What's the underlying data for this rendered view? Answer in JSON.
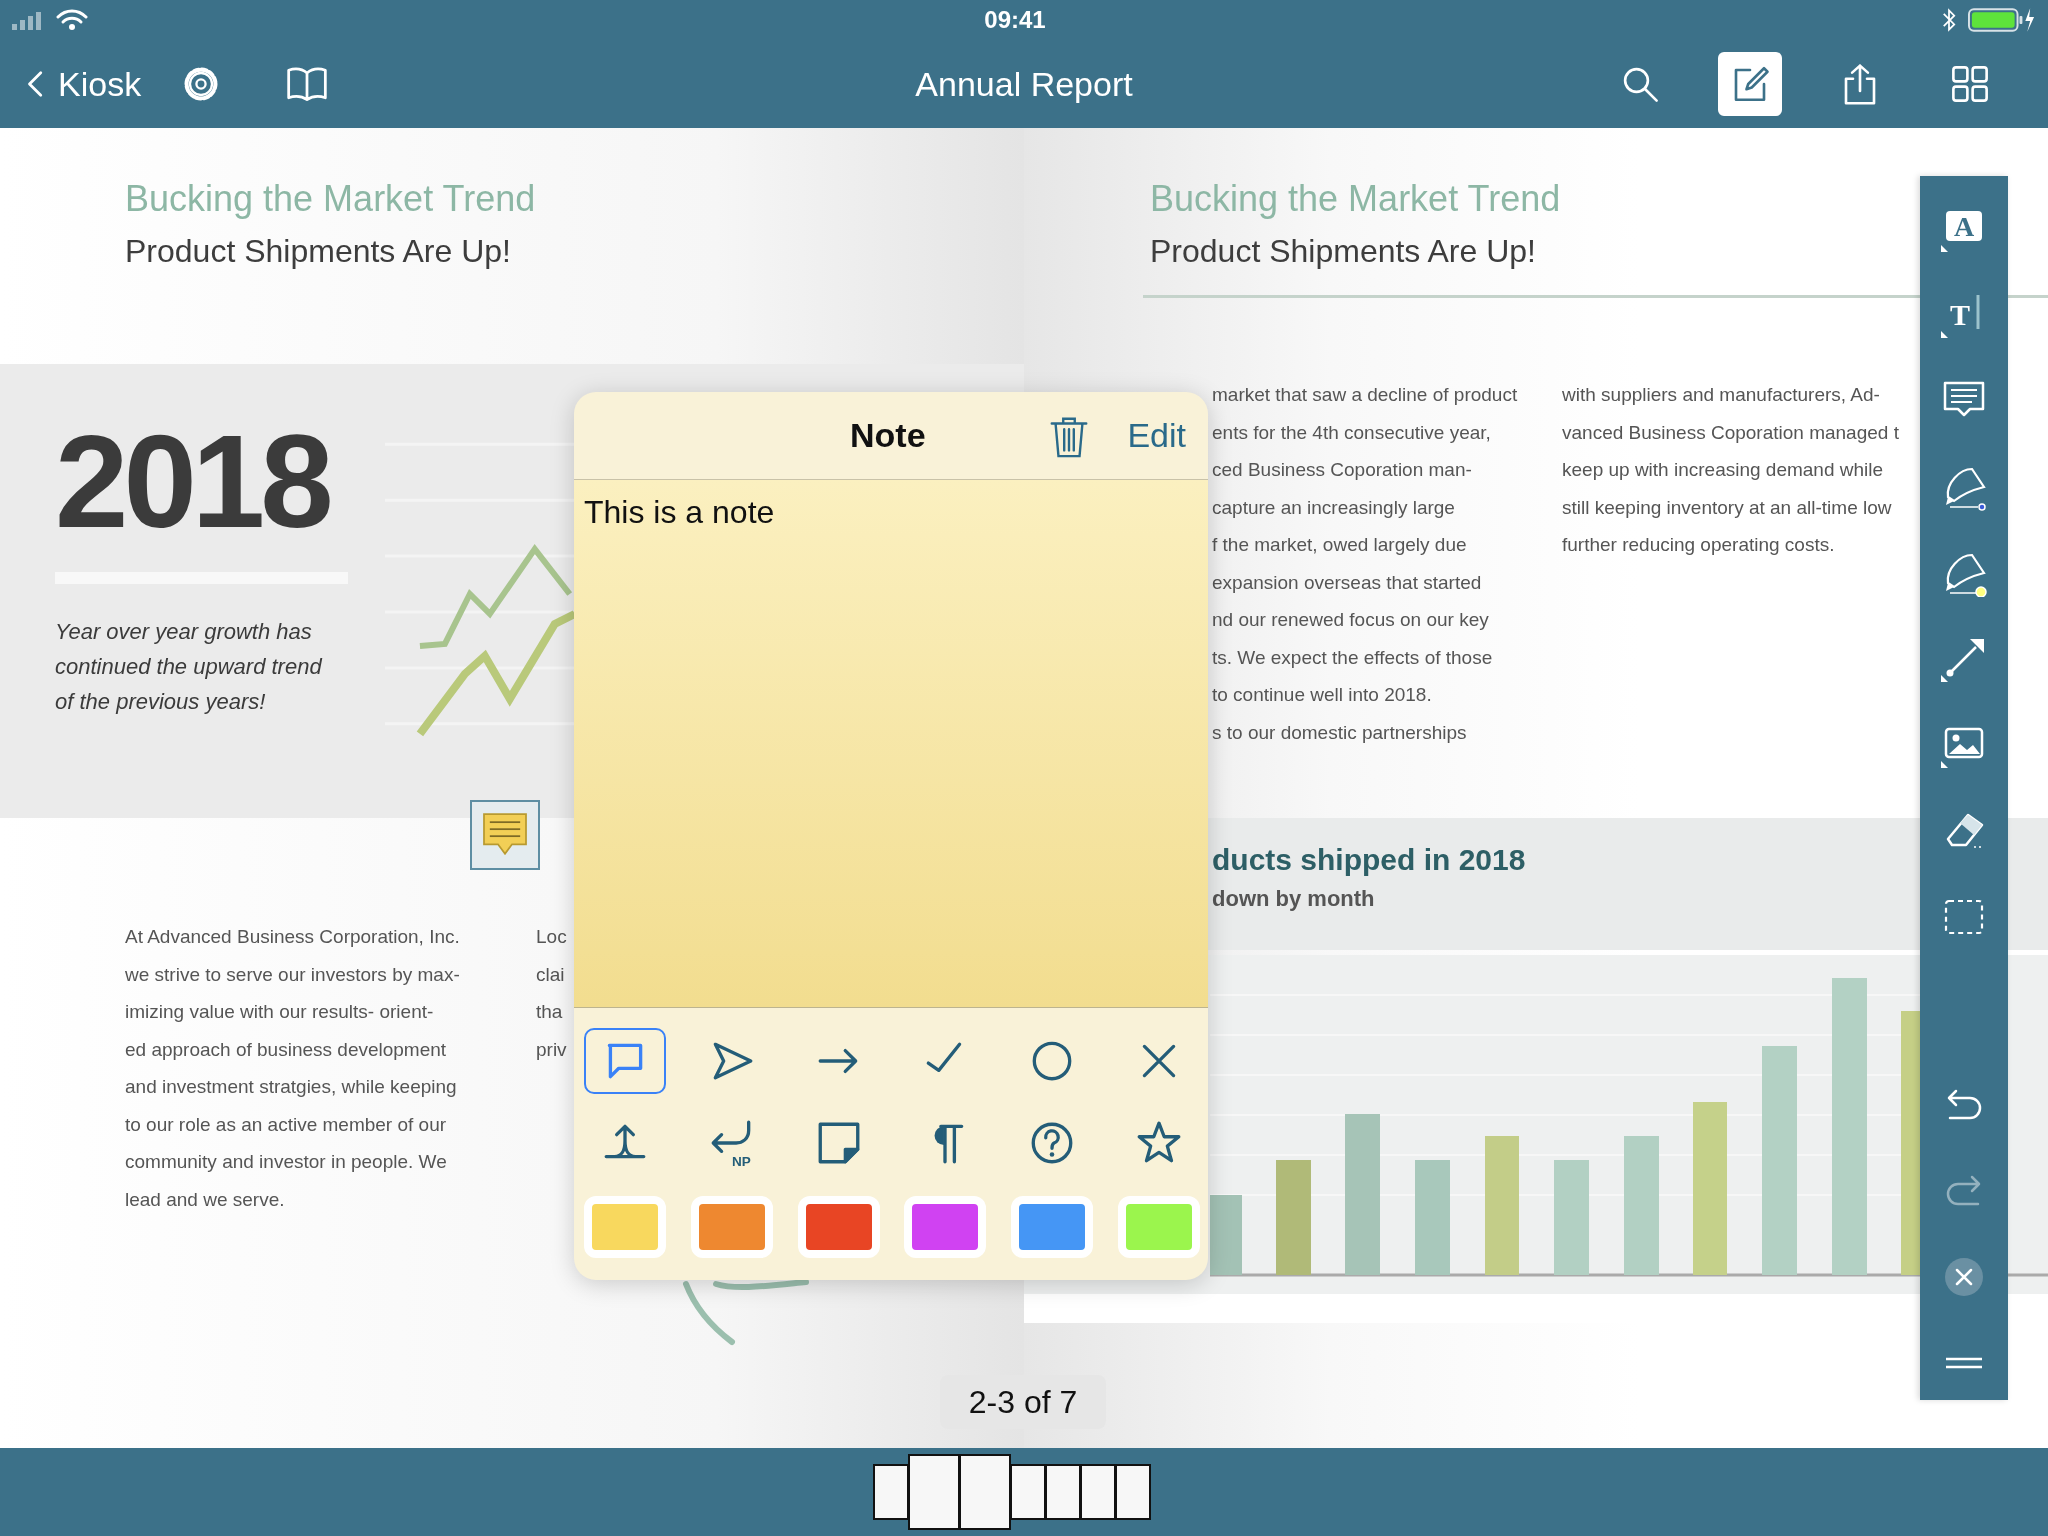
{
  "status_bar": {
    "time": "09:41"
  },
  "nav_bar": {
    "back": "Kiosk",
    "title": "Annual Report",
    "left_tools": [
      {
        "kind": "settings"
      },
      {
        "kind": "book"
      }
    ],
    "right_tools": [
      {
        "kind": "search",
        "selected": false
      },
      {
        "kind": "edit",
        "selected": true
      },
      {
        "kind": "share",
        "selected": false
      },
      {
        "kind": "grid",
        "selected": false
      }
    ]
  },
  "left_page": {
    "heading": "Bucking the Market Trend",
    "subheading": "Product Shipments Are Up!",
    "year": "2018",
    "tagline": [
      "Year over year growth has",
      "continued the upward trend",
      "of the previous years!"
    ],
    "column_1": [
      "At Advanced Business Corporation, Inc.",
      "we strive to serve our investors  by max-",
      "imizing value with our results- orient-",
      "ed approach of business development",
      "and investment stratgies, while keeping",
      "to our role as an active member of our",
      "community and investor in people. We",
      "lead and we serve."
    ],
    "column_2": [
      "Loc",
      "clai",
      "tha",
      "priv"
    ]
  },
  "right_page": {
    "heading": "Bucking the Market Trend",
    "subheading": "Product Shipments Are Up!",
    "column_1": [
      "market that saw a decline of product",
      "ents for the 4th consecutive year,",
      "ced Business Coporation man-",
      "capture an increasingly large",
      "f the market, owed largely due",
      "expansion overseas that started",
      "nd our renewed focus on our key",
      "ts. We expect the effects of those",
      "to continue well into 2018.",
      "s to our domestic partnerships"
    ],
    "column_2": [
      "with suppliers and manufacturers, Ad-",
      "vanced Business Coporation managed t",
      "keep up with increasing demand while",
      "still keeping inventory at an all-time low",
      "further reducing operating costs."
    ],
    "chart_title": "ducts shipped in 2018",
    "chart_subtitle": "down by month"
  },
  "note_popup": {
    "title": "Note",
    "action": "Edit",
    "text": "This is a note",
    "stamps": [
      {
        "kind": "comment",
        "selected": true
      },
      {
        "kind": "send",
        "selected": false
      },
      {
        "kind": "arrow",
        "selected": false
      },
      {
        "kind": "check",
        "selected": false
      },
      {
        "kind": "circle",
        "selected": false
      },
      {
        "kind": "cross",
        "selected": false
      },
      {
        "kind": "insert",
        "selected": false
      },
      {
        "kind": "new-paragraph",
        "label": "NP",
        "selected": false
      },
      {
        "kind": "note",
        "selected": false
      },
      {
        "kind": "paragraph",
        "selected": false
      },
      {
        "kind": "help",
        "selected": false
      },
      {
        "kind": "star",
        "selected": false
      }
    ],
    "colors": [
      {
        "color": "#f8d85e",
        "selected": false
      },
      {
        "color": "#ee8830",
        "selected": false
      },
      {
        "color": "#e84524",
        "selected": false
      },
      {
        "color": "#d042f2",
        "selected": false
      },
      {
        "color": "#4596f5",
        "selected": false
      },
      {
        "color": "#9bf54d",
        "selected": false
      }
    ]
  },
  "annotation_toolbar": [
    {
      "kind": "text-box",
      "glyph": "A",
      "disabled": false
    },
    {
      "kind": "typewriter",
      "glyph": "T",
      "disabled": false
    },
    {
      "kind": "comment",
      "disabled": false
    },
    {
      "kind": "pen",
      "disabled": false
    },
    {
      "kind": "highlighter",
      "disabled": false
    },
    {
      "kind": "line",
      "disabled": false
    },
    {
      "kind": "image",
      "disabled": false
    },
    {
      "kind": "eraser",
      "disabled": false
    },
    {
      "kind": "select",
      "disabled": false
    },
    {
      "kind": "spacer"
    },
    {
      "kind": "undo",
      "disabled": false
    },
    {
      "kind": "redo",
      "disabled": true
    },
    {
      "kind": "close",
      "disabled": false
    },
    {
      "kind": "menu",
      "disabled": false
    }
  ],
  "page_counter": "2-3 of 7",
  "thumbnails": [
    {
      "selected": false
    },
    {
      "selected": true
    },
    {
      "selected": true
    },
    {
      "selected": false
    },
    {
      "selected": false
    },
    {
      "selected": false
    },
    {
      "selected": false
    }
  ]
}
